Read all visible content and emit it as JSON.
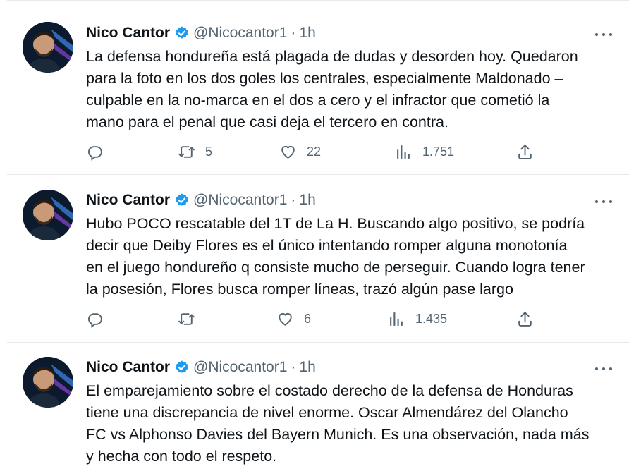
{
  "tweets": [
    {
      "author_name": "Nico Cantor",
      "handle": "@Nicocantor1",
      "separator": "·",
      "time": "1h",
      "text": "La defensa hondureña está plagada de dudas y desorden hoy. Quedaron\npara la foto en los dos goles los centrales, especialmente Maldonado –\nculpable en la no-marca en el dos a cero y el infractor que cometió la\nmano para el penal que casi deja el tercero en contra.",
      "replies": "",
      "retweets": "5",
      "likes": "22",
      "views": "1.751"
    },
    {
      "author_name": "Nico Cantor",
      "handle": "@Nicocantor1",
      "separator": "·",
      "time": "1h",
      "text": "Hubo POCO rescatable del 1T de La H. Buscando algo positivo, se podría\ndecir que Deiby Flores es el único intentando romper alguna monotonía\nen el juego hondureño q consiste mucho de perseguir. Cuando logra tener\nla posesión, Flores busca romper líneas, trazó algún pase largo",
      "replies": "",
      "retweets": "",
      "likes": "6",
      "views": "1.435"
    },
    {
      "author_name": "Nico Cantor",
      "handle": "@Nicocantor1",
      "separator": "·",
      "time": "1h",
      "text": "El emparejamiento sobre el costado derecho de la defensa de Honduras\ntiene una discrepancia de nivel enorme. Oscar Almendárez del Olancho\nFC vs Alphonso Davies del Bayern Munich. Es una observación, nada más\ny hecha con todo el respeto."
    }
  ],
  "icons": {
    "reply": "reply-icon",
    "retweet": "retweet-icon",
    "like": "heart-icon",
    "views": "views-icon",
    "share": "share-icon",
    "verified": "verified-badge-icon",
    "more": "more-options-icon"
  },
  "colors": {
    "verified": "#1d9bf0",
    "secondary_text": "#536471",
    "primary_text": "#0f1419",
    "divider": "#e7e9ea"
  }
}
